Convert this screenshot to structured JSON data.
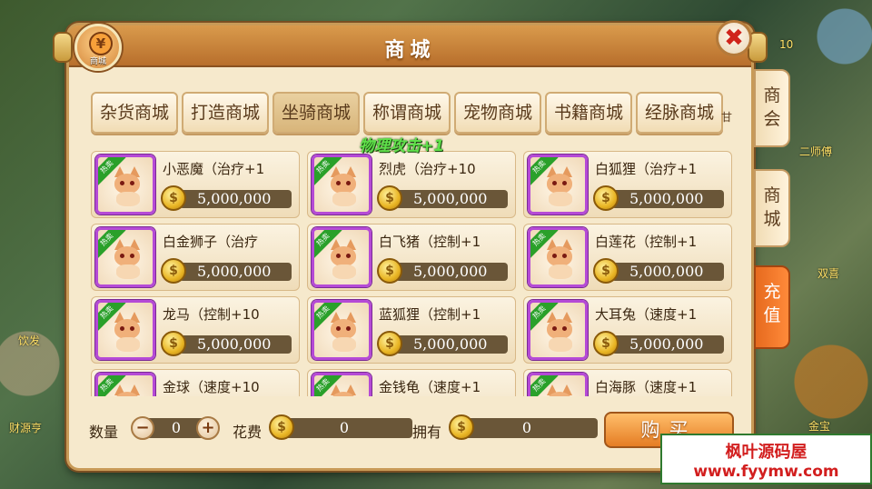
{
  "window": {
    "title": "商城",
    "emblem_label": "商城",
    "close_label": "✖"
  },
  "tabs": [
    {
      "label": "杂货商城",
      "active": false
    },
    {
      "label": "打造商城",
      "active": false
    },
    {
      "label": "坐骑商城",
      "active": true
    },
    {
      "label": "称谓商城",
      "active": false
    },
    {
      "label": "宠物商城",
      "active": false
    },
    {
      "label": "书籍商城",
      "active": false
    },
    {
      "label": "经脉商城",
      "active": false
    }
  ],
  "tab_overflow": "甘",
  "float_text": "物理攻击+1",
  "hot_badge": "热卖",
  "items": [
    {
      "name": "小恶魔（治疗+1",
      "price": "5,000,000"
    },
    {
      "name": "烈虎（治疗+10",
      "price": "5,000,000"
    },
    {
      "name": "白狐狸（治疗+1",
      "price": "5,000,000"
    },
    {
      "name": "白金狮子（治疗",
      "price": "5,000,000"
    },
    {
      "name": "白飞猪（控制+1",
      "price": "5,000,000"
    },
    {
      "name": "白莲花（控制+1",
      "price": "5,000,000"
    },
    {
      "name": "龙马（控制+10",
      "price": "5,000,000"
    },
    {
      "name": "蓝狐狸（控制+1",
      "price": "5,000,000"
    },
    {
      "name": "大耳兔（速度+1",
      "price": "5,000,000"
    },
    {
      "name": "金球（速度+10",
      "price": ""
    },
    {
      "name": "金钱龟（速度+1",
      "price": ""
    },
    {
      "name": "白海豚（速度+1",
      "price": ""
    }
  ],
  "side_tabs": [
    {
      "label": "商\n会"
    },
    {
      "label": "商\n城"
    },
    {
      "label": "充\n值"
    }
  ],
  "bottom": {
    "quantity_label": "数量",
    "quantity_value": "0",
    "minus": "−",
    "plus": "+",
    "cost_label": "花费",
    "cost_value": "0",
    "owned_label": "拥有",
    "owned_value": "0",
    "buy_label": "购买"
  },
  "background": {
    "left_text_1": "饮发",
    "left_text_2": "财源亨",
    "right_text_1": "二师傅",
    "right_text_2": "双喜",
    "right_text_3": "金宝",
    "corner_text": "10"
  },
  "watermark": {
    "title": "枫叶源码屋",
    "url": "www.fyymw.com"
  },
  "colors": {
    "panel_bg": "#f6e9cc",
    "title_bar": "#c9843c",
    "active_tab": "#d8b57a",
    "price_bar": "#6a5638",
    "rare_border": "#b54ad6",
    "float_text": "#5fe04a",
    "buy_button": "#e57d24",
    "recharge_tab": "#ff8a3a"
  }
}
